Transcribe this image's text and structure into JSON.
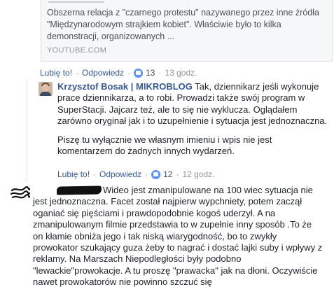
{
  "preview": {
    "description": "Obszerna relacja z \"czarnego protestu\" nazywanego przez inne źródła \"Międzynarodowym strajkiem kobiet\". Właściwie było to kilka demonstracji, organizowanych ...",
    "domain": "YOUTUBE.COM"
  },
  "comment1_actions": {
    "like": "Lubię to!",
    "reply": "Odpowiedz",
    "reaction_count": "13",
    "time": "13 godz."
  },
  "reply1": {
    "author": "Krzysztof Bosak | MIKROBLOG",
    "paragraph1": "Tak, dziennikarz jeśli wykonuje prace dziennikarza, a to robi. Prowadzi także swój program w SuperStacji. Jajcarz też, ale to się nie wyklucza. Oglądałem zarówno oryginał jak i to uzupełnienie i sytuacja jest jednoznaczna.",
    "paragraph2": "Piszę tu wyłącznie we własnym imieniu i wpis nie jest komentarzem do żadnych innych wydarzeń.",
    "actions": {
      "like": "Lubię to!",
      "reply": "Odpowiedz",
      "reaction_count": "12",
      "time": "12 godz."
    }
  },
  "comment2": {
    "text": "Wideo jest zmanipulowane na 100 wiec sytuacja nie jest jednoznaczna. Facet został najpierw wypchniety, potem zaczął oganiać się pięściami i prawdopodobnie kogoś uderzył. A na zmanipulowanym filmie przedstawia to w zupełnie inny sposób .To że on kłamie obniża jego i tak niską wiarygodność, bo to zwykły prowokator szukający guza żeby to nagrać i dostać lajki suby i wpływy z reklamy. Na Marszach Niepodległości były podobno \"lewackie\"prowokacje. A tu proszę \"prawacka\" jak na dłoni. Oczywiście nawet prowokatorów nie powinno szczuć się"
  },
  "colors": {
    "link": "#365899",
    "text": "#1d2129",
    "meta": "#90949c",
    "like_badge": "#5890ff"
  }
}
